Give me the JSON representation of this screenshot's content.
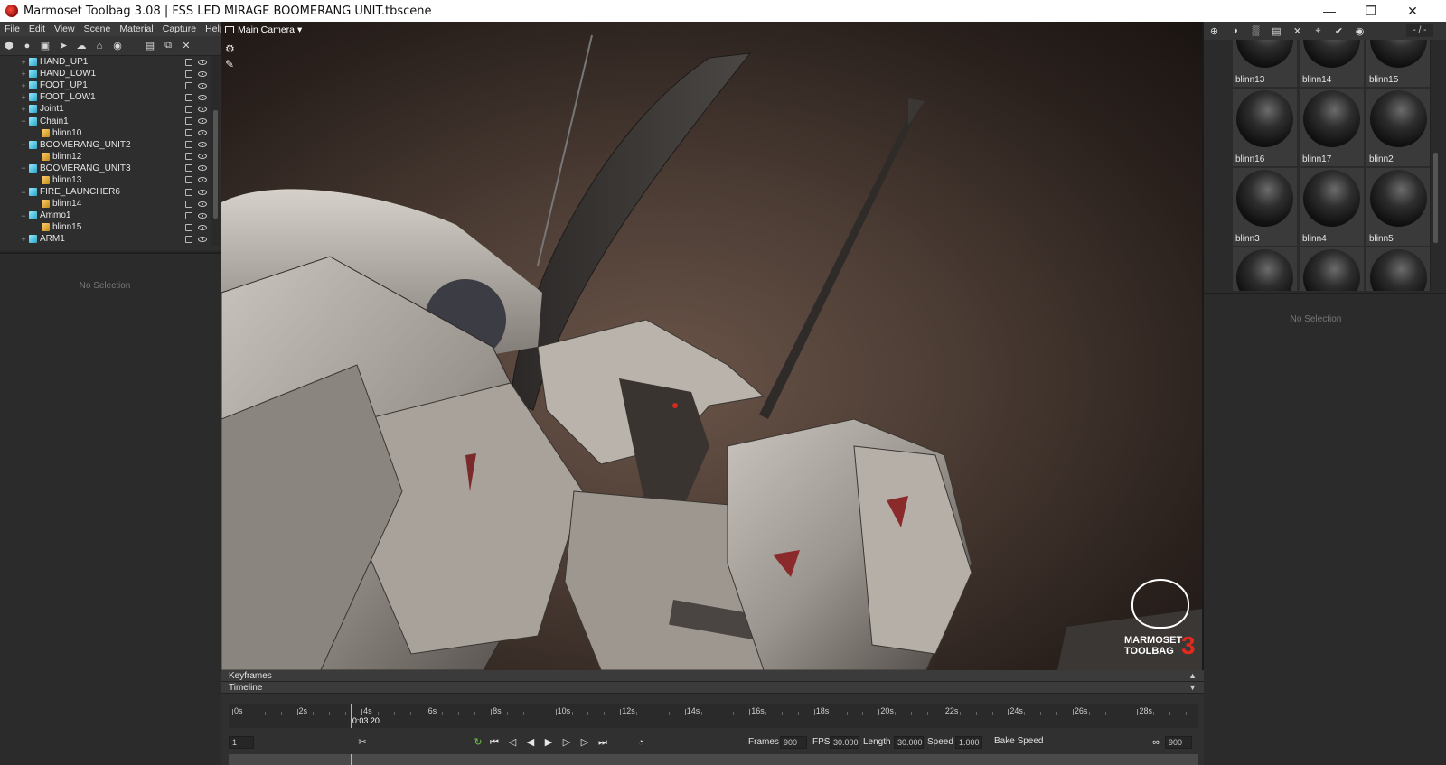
{
  "window": {
    "title": "Marmoset Toolbag 3.08  |  FSS LED MIRAGE BOOMERANG UNIT.tbscene",
    "minimize": "—",
    "restore": "❐",
    "close": "✕"
  },
  "menu": [
    "File",
    "Edit",
    "View",
    "Scene",
    "Material",
    "Capture",
    "Help"
  ],
  "left_toolbar_icons": [
    "object-icon",
    "light-icon",
    "camera-icon",
    "animation-icon",
    "shadow-icon",
    "sky-icon",
    "render-icon",
    "folder-icon",
    "duplicate-icon",
    "delete-icon"
  ],
  "outliner": {
    "items": [
      {
        "label": "HAND_UP1",
        "kind": "mesh",
        "depth": 0
      },
      {
        "label": "HAND_LOW1",
        "kind": "mesh",
        "depth": 0
      },
      {
        "label": "FOOT_UP1",
        "kind": "mesh",
        "depth": 0
      },
      {
        "label": "FOOT_LOW1",
        "kind": "mesh",
        "depth": 0
      },
      {
        "label": "Joint1",
        "kind": "mesh",
        "depth": 0
      },
      {
        "label": "Chain1",
        "kind": "mesh",
        "depth": 0
      },
      {
        "label": "blinn10",
        "kind": "mat",
        "depth": 1
      },
      {
        "label": "BOOMERANG_UNIT2",
        "kind": "mesh",
        "depth": 0
      },
      {
        "label": "blinn12",
        "kind": "mat",
        "depth": 1
      },
      {
        "label": "BOOMERANG_UNIT3",
        "kind": "mesh",
        "depth": 0
      },
      {
        "label": "blinn13",
        "kind": "mat",
        "depth": 1
      },
      {
        "label": "FIRE_LAUNCHER6",
        "kind": "mesh",
        "depth": 0
      },
      {
        "label": "blinn14",
        "kind": "mat",
        "depth": 1
      },
      {
        "label": "Ammo1",
        "kind": "mesh",
        "depth": 0
      },
      {
        "label": "blinn15",
        "kind": "mat",
        "depth": 1
      },
      {
        "label": "ARM1",
        "kind": "mesh",
        "depth": 0
      }
    ]
  },
  "left_properties": {
    "empty_text": "No Selection"
  },
  "viewport": {
    "camera": "Main Camera ▾",
    "logo_text_1": "MARMOSET",
    "logo_text_2": "TOOLBAG",
    "logo_version": "3"
  },
  "materials": {
    "page": "- / -",
    "items": [
      "blinn13",
      "blinn14",
      "blinn15",
      "blinn16",
      "blinn17",
      "blinn2",
      "blinn3",
      "blinn4",
      "blinn5",
      "",
      "",
      ""
    ]
  },
  "right_properties": {
    "empty_text": "No Selection"
  },
  "timeline": {
    "keyframes_label": "Keyframes",
    "timeline_label": "Timeline",
    "ticks": [
      "0s",
      "2s",
      "4s",
      "6s",
      "8s",
      "10s",
      "12s",
      "14s",
      "16s",
      "18s",
      "20s",
      "22s",
      "24s",
      "26s",
      "28s"
    ],
    "current_time": "0:03.20",
    "current_fraction": 0.122,
    "frame_field": "1",
    "frames_label": "Frames",
    "frames_value": "900",
    "fps_label": "FPS",
    "fps_value": "30.000",
    "length_label": "Length",
    "length_value": "30.000",
    "speed_label": "Speed",
    "speed_value": "1.000",
    "bake_speed_label": "Bake Speed",
    "end_frame": "900"
  },
  "colors": {
    "accent_playhead": "#e3b53a",
    "logo_red": "#e12a1e"
  }
}
